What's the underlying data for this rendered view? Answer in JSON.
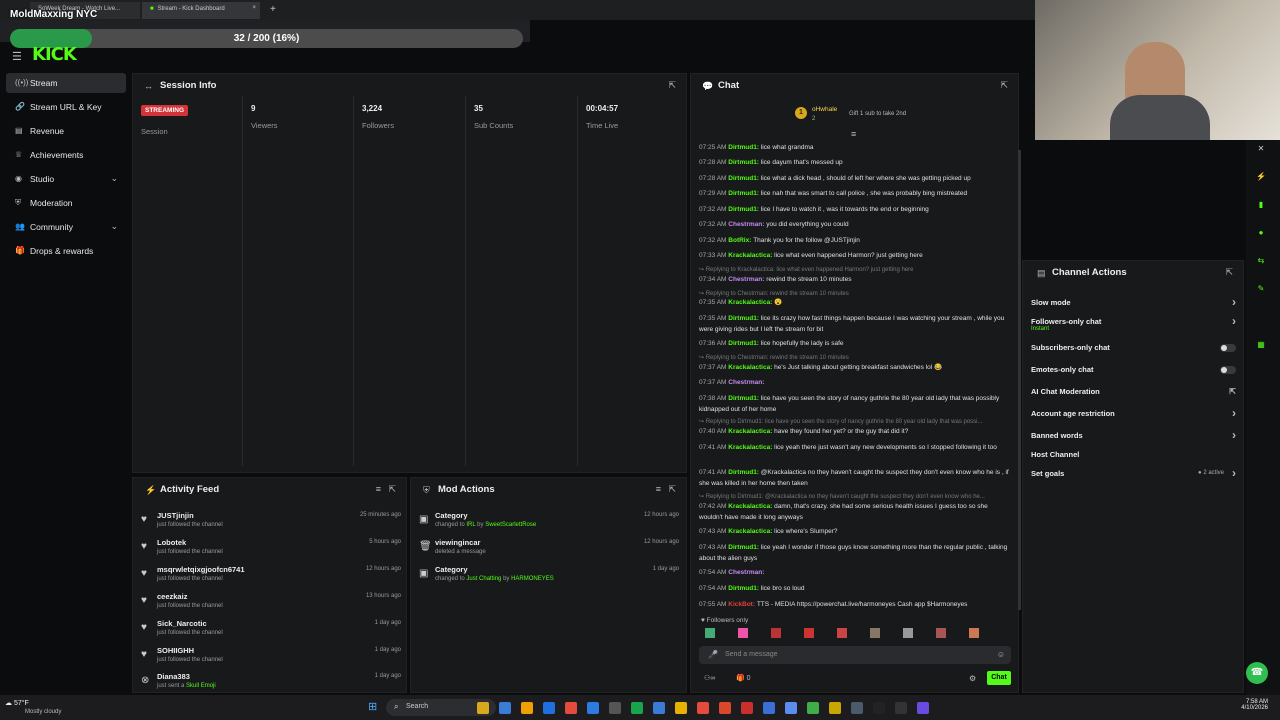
{
  "browser": {
    "tab1": "SoWeek Dream - Watch Live...",
    "tab2": "Stream - Kick Dashboard",
    "newtab": "+",
    "close": "×"
  },
  "overlay": {
    "title": "MoldMaxxing NYC",
    "progress_text": "32 / 200 (16%)",
    "progress_fraction": 0.16
  },
  "brand": {
    "logo": "KICK",
    "accent": "#53fc18"
  },
  "sidebar": {
    "items": [
      {
        "label": "Stream",
        "icon": "broadcast-icon"
      },
      {
        "label": "Stream URL & Key",
        "icon": "link-icon"
      },
      {
        "label": "Revenue",
        "icon": "money-icon"
      },
      {
        "label": "Achievements",
        "icon": "trophy-icon"
      },
      {
        "label": "Studio",
        "icon": "studio-icon"
      },
      {
        "label": "Moderation",
        "icon": "shield-icon"
      },
      {
        "label": "Community",
        "icon": "users-icon"
      },
      {
        "label": "Drops & rewards",
        "icon": "gift-icon"
      }
    ]
  },
  "session": {
    "title": "Session Info",
    "status": "STREAMING",
    "stats": [
      {
        "value": "",
        "label": "Session"
      },
      {
        "value": "9",
        "label": "Viewers"
      },
      {
        "value": "3,224",
        "label": "Followers"
      },
      {
        "value": "35",
        "label": "Sub Counts"
      },
      {
        "value": "00:04:57",
        "label": "Time Live"
      }
    ]
  },
  "activity": {
    "title": "Activity Feed",
    "items": [
      {
        "name": "JUSTjinjin",
        "sub": "just followed the channel",
        "time": "25 minutes ago"
      },
      {
        "name": "Lobotek",
        "sub": "just followed the channel",
        "time": "5 hours ago"
      },
      {
        "name": "msqrwletqixgjoofcn6741",
        "sub": "just followed the channel",
        "time": "12 hours ago"
      },
      {
        "name": "ceezkaiz",
        "sub": "just followed the channel",
        "time": "13 hours ago"
      },
      {
        "name": "Sick_Narcotic",
        "sub": "just followed the channel",
        "time": "1 day ago"
      },
      {
        "name": "SOHIIGHH",
        "sub": "just followed the channel",
        "time": "1 day ago"
      },
      {
        "name": "Diana383",
        "sub": "just sent a",
        "sub2": "Skull Emoji",
        "time": "1 day ago"
      }
    ]
  },
  "mod": {
    "title": "Mod Actions",
    "items": [
      {
        "name": "Category",
        "sub": "changed to",
        "hl": "IRL",
        "by": "by",
        "hl2": "SweetScarlettRose",
        "time": "12 hours ago"
      },
      {
        "name": "viewingincar",
        "sub": "deleted a message",
        "hl": "",
        "by": "",
        "hl2": "",
        "time": "12 hours ago"
      },
      {
        "name": "Category",
        "sub": "changed to",
        "hl": "Just Chatting",
        "by": "by",
        "hl2": "HARMONEYES",
        "time": "1 day ago"
      }
    ]
  },
  "chat": {
    "title": "Chat",
    "pinned_user": "oHwhale",
    "pinned_note": "Gift 1 sub to take 2nd",
    "pinned_count": "2",
    "followers_only": "Followers only",
    "placeholder": "Send a message",
    "send": "Chat",
    "count_a": "0",
    "messages": [
      {
        "t": "07:25 AM",
        "u": "Dirtmud1:",
        "c": "#53fc18",
        "m": "lice what grandma"
      },
      {
        "t": "07:28 AM",
        "u": "Dirtmud1:",
        "c": "#53fc18",
        "m": "lice dayum that's messed up"
      },
      {
        "t": "07:28 AM",
        "u": "Dirtmud1:",
        "c": "#53fc18",
        "m": "lice what a dick head , should of left her where she was getting picked up"
      },
      {
        "t": "07:29 AM",
        "u": "Dirtmud1:",
        "c": "#53fc18",
        "m": "lice nah that was smart to call police , she was probably bing mistreated"
      },
      {
        "t": "07:32 AM",
        "u": "Dirtmud1:",
        "c": "#53fc18",
        "m": "lice I have to watch it , was it towards the end or beginning"
      },
      {
        "t": "07:32 AM",
        "u": "Chestrman:",
        "c": "#c58cf0",
        "m": "you did everything you could"
      },
      {
        "t": "07:32 AM",
        "u": "BotRix:",
        "c": "#53fc18",
        "m": "Thank you for the follow @JUSTjinjin"
      },
      {
        "t": "07:33 AM",
        "u": "Krackalactica:",
        "c": "#53fc18",
        "m": "lice what even happened Harmon? just getting here"
      },
      {
        "t": "07:34 AM",
        "u": "Chestrman:",
        "c": "#c58cf0",
        "m": "rewind the stream 10 minutes"
      },
      {
        "t": "07:35 AM",
        "u": "Krackalactica:",
        "c": "#53fc18",
        "m": "😮"
      },
      {
        "t": "07:35 AM",
        "u": "Dirtmud1:",
        "c": "#53fc18",
        "m": "lice its crazy how fast things happen because I was watching your stream , while you were giving rides but I left the stream for bit"
      },
      {
        "t": "07:36 AM",
        "u": "Dirtmud1:",
        "c": "#53fc18",
        "m": "lice hopefully the lady is safe"
      },
      {
        "t": "07:37 AM",
        "u": "Krackalactica:",
        "c": "#53fc18",
        "m": "he's Just talking about getting breakfast sandwiches lol 😂"
      },
      {
        "t": "07:37 AM",
        "u": "Chestrman:",
        "c": "#c58cf0",
        "m": ""
      },
      {
        "t": "07:38 AM",
        "u": "Dirtmud1:",
        "c": "#53fc18",
        "m": "lice have you seen the story of nancy guthrie the 80 year old lady that was possibly kidnapped out of her home"
      },
      {
        "t": "07:40 AM",
        "u": "Krackalactica:",
        "c": "#53fc18",
        "m": "have they found her yet? or the guy that did it?"
      },
      {
        "t": "07:41 AM",
        "u": "Krackalactica:",
        "c": "#53fc18",
        "m": "lice yeah there just wasn't any new developments so I stopped following it too"
      },
      {
        "t": "07:41 AM",
        "u": "Dirtmud1:",
        "c": "#53fc18",
        "m": "@Krackalactica no they haven't caught the suspect they don't even know who he is , if she was killed in her home then taken"
      },
      {
        "t": "07:42 AM",
        "u": "Krackalactica:",
        "c": "#53fc18",
        "m": "damn, that's crazy. she had some serious health issues I guess too so she wouldn't have made it long anyways"
      },
      {
        "t": "07:43 AM",
        "u": "Krackalactica:",
        "c": "#53fc18",
        "m": "lice where's Slumper?"
      },
      {
        "t": "07:43 AM",
        "u": "Dirtmud1:",
        "c": "#53fc18",
        "m": "lice yeah I wonder if those guys know something more than the regular public , talking about the alien guys"
      },
      {
        "t": "07:54 AM",
        "u": "Chestrman:",
        "c": "#c58cf0",
        "m": ""
      },
      {
        "t": "07:54 AM",
        "u": "Dirtmud1:",
        "c": "#53fc18",
        "m": "lice bro so loud"
      },
      {
        "t": "07:55 AM",
        "u": "KickBot:",
        "c": "#e0413b",
        "m": "TTS - MEDIA https://powerchat.live/harmoneyes Cash app $Harmoneyes"
      }
    ],
    "replies": [
      "Replying to Krackalactica: lice what even happened Harmon? just getting here",
      "Replying to Chestrman: rewind the stream 10 minutes",
      "Replying to Chestrman: rewind the stream 10 minutes",
      "Replying to Dirtmud1: lice have you seen the story of nancy guthrie the 80 year old lady that was possi...",
      "Replying to Dirtmud1: @Krackalactica no they haven't caught the suspect they don't even know who he..."
    ]
  },
  "channel_actions": {
    "title": "Channel Actions",
    "rows": [
      {
        "label": "Slow mode",
        "sub": "",
        "ctrl": "chevron"
      },
      {
        "label": "Followers-only chat",
        "sub": "Instant",
        "ctrl": "chevron"
      },
      {
        "label": "Subscribers-only chat",
        "sub": "",
        "ctrl": "toggle"
      },
      {
        "label": "Emotes-only chat",
        "sub": "",
        "ctrl": "toggle"
      },
      {
        "label": "AI Chat Moderation",
        "sub": "",
        "ctrl": "external"
      },
      {
        "label": "Account age restriction",
        "sub": "",
        "ctrl": "chevron"
      },
      {
        "label": "Banned words",
        "sub": "",
        "ctrl": "chevron"
      },
      {
        "label": "Host Channel",
        "sub": "",
        "ctrl": "none"
      },
      {
        "label": "Set goals",
        "sub": "2 active",
        "ctrl": "chevron"
      }
    ]
  },
  "taskbar": {
    "weather_temp": "57°F",
    "weather_desc": "Mostly cloudy",
    "search": "Search",
    "time": "7:58 AM",
    "date": "4/10/2026"
  }
}
